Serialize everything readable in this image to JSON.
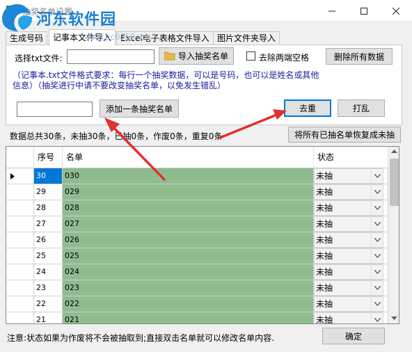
{
  "window": {
    "title": "抽奖名单设置"
  },
  "watermark": {
    "text": "河东软件园",
    "url": "www.pc0359.cn"
  },
  "tabs": [
    "生成号码",
    "记事本文件导入",
    "Excel电子表格文件导入",
    "图片文件夹导入"
  ],
  "import_panel": {
    "txt_file_label": "选择txt文件:",
    "txt_file_value": "",
    "import_button": "导入抽奖名单",
    "trim_checkbox_label": "去除两端空格",
    "trim_checked": false,
    "delete_all_button": "删除所有数据",
    "format_note": "（记事本.txt文件格式要求：每行一个抽奖数据，可以是号码，也可以是姓名或其他信息）（抽奖进行中请不要改变抽奖名单，以免发生错乱）",
    "add_input_value": "",
    "add_button": "添加一条抽奖名单",
    "dedupe_button": "去重",
    "shuffle_button": "打乱"
  },
  "status_text": "数据总共30条，未抽30条，已抽0条，作废0条，重复0条",
  "restore_button": "将所有已抽名单恢复成未抽",
  "grid": {
    "columns": [
      "序号",
      "名单",
      "状态"
    ],
    "rows": [
      {
        "seq": "30",
        "name": "030",
        "status": "未抽",
        "current": true
      },
      {
        "seq": "29",
        "name": "029",
        "status": "未抽"
      },
      {
        "seq": "28",
        "name": "028",
        "status": "未抽"
      },
      {
        "seq": "27",
        "name": "027",
        "status": "未抽"
      },
      {
        "seq": "26",
        "name": "026",
        "status": "未抽"
      },
      {
        "seq": "25",
        "name": "025",
        "status": "未抽"
      },
      {
        "seq": "24",
        "name": "024",
        "status": "未抽"
      },
      {
        "seq": "23",
        "name": "023",
        "status": "未抽"
      },
      {
        "seq": "22",
        "name": "022",
        "status": "未抽"
      },
      {
        "seq": "21",
        "name": "021",
        "status": "未抽"
      }
    ]
  },
  "footer_note": "注意:状态如果为作废将不会被抽取到;直接双击名单就可以修改名单内容.",
  "ok_button": "确定",
  "colors": {
    "name_cell": "#8fbc8f",
    "seq_selected": "#0078d7",
    "note_text": "#1a1a9a",
    "arrow": "#e03030"
  }
}
